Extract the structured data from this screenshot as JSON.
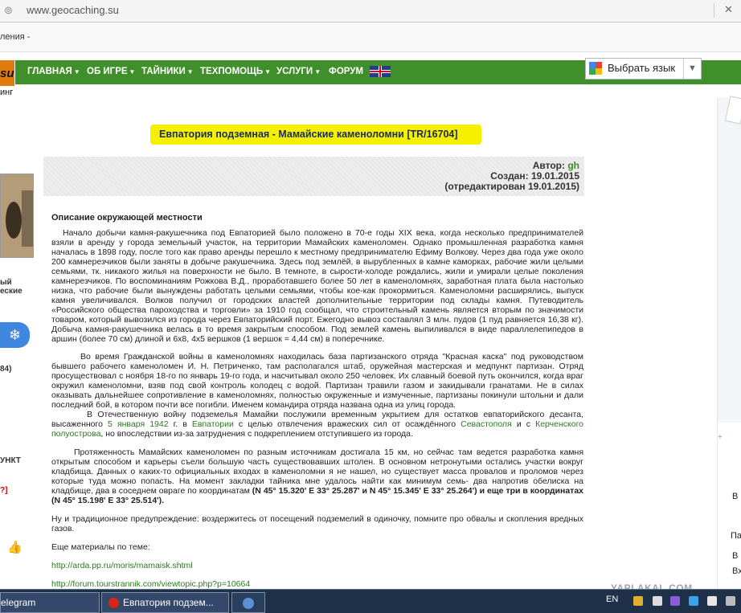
{
  "browser": {
    "url": "www.geocaching.su",
    "bookmarks_text": "ления -"
  },
  "site": {
    "logo_text": "su",
    "logo_sub": "инг",
    "nav": [
      "ГЛАВНАЯ",
      "ОБ ИГРЕ",
      "ТАЙНИКИ",
      "ТЕХПОМОЩЬ",
      "УСЛУГИ",
      "ФОРУМ"
    ],
    "translate_label": "Выбрать язык"
  },
  "cache": {
    "title": "Евпатория подземная - Мамайские каменоломни [TR/16704]",
    "author_label": "Автор:",
    "author": "gh",
    "created": "Создан: 19.01.2015",
    "edited": "(отредактирован 19.01.2015)",
    "section_title": "Описание окружающей местности",
    "p1": "Начало добычи камня-ракушечника под Евпаторией было положено в 70-е годы XIX века, когда несколько предпринимателей взяли в аренду у города земельный участок, на территории Мамайских каменоломен. Однако промышленная разработка камня началась в 1898 году, после того как право аренды перешло к местному предпринимателю Ефиму Волкову. Через два года уже около 200 камнерезчиков были заняты в добыче ракушечника. Здесь под землёй, в вырубленных в камне каморках, рабочие жили целыми семьями, тк. никакого жилья на поверхности не было. В темноте, в сырости-холоде рождались, жили и умирали целые поколения камнерезчиков. По воспоминаниям Рожкова В.Д., проработавшего более 50 лет в каменоломнях, заработная плата была настолько низка, что рабочие были вынуждены работать целыми семьями, чтобы кое-как прокормиться. Каменоломни расширялись, выпуск камня увеличивался. Волков получил от городских властей дополнительные территории под склады камня. Путеводитель «Российского общества пароходства и торговли» за 1910 год сообщал, что строительный камень является вторым по значимости товаром, который вывозился из города через Евпаторийский порт. Ежегодно вывоз составлял 3 млн. пудов (1 пуд равняется 16,38 кг). Добыча камня-ракушечника велась в то время закрытым способом. Под землей камень выпиливался в виде параллелепипедов в аршин (более 70 см) длиной и 6х8, 4х5 вершков (1 вершок = 4,44 см) в поперечнике.",
    "p2": "Во время Гражданской войны в каменоломнях находилась база партизанского отряда \"Красная каска\" под руководством бывшего рабочего каменоломен И. Н. Петриченко, там раcполагался штаб, оружейная мастерская и медпункт партизан. Отряд просуществовал с ноября 18-го по январь 19-го года, и насчитывал около 250 человек. Их славный боевой путь окончился, когда враг окружил каменоломни, взяв под свой контроль колодец с водой. Партизан травили газом и закидывали гранатами. Не в силах оказывать дальнейшее сопротивление в каменоломнях, полностью окруженные и измученные, партизаны покинули штольни и дали последний бой, в котором почти все погибли. Именем командира отряда названа одна из улиц города.",
    "p3_a": "В Отечественную войну подземелья Мамайки послужили временным укрытием для остатков евпаторийского десанта, высаженного ",
    "p3_link1": "5 января",
    "p3_link2": "1942",
    "p3_b": " г. в ",
    "p3_link3": "Евпатории",
    "p3_c": " с целью отвлечения вражеских сил от осаждённого ",
    "p3_link4": "Севастополя",
    "p3_d": " и с ",
    "p3_link5": "Керченского полуострова",
    "p3_e": ", но впоследствии из-за затруднения с подкреплением отступившего из города.",
    "p4_a": "Протяженность Мамайских каменоломен по разным источникам достигала 15 км, но сейчас там ведется разработка камня открытым способом и карьеры съели большую часть существовавших штолен.  В основном нетронутыми остались участки вокруг кладбища. Данных о каких-то официальных входах в каменоломни я не нашел, но существует масса провалов и проломов через которые туда можно попасть. На момент закладки тайника мне удалось найти как минимум семь- два напротив обелиска на кладбище,  два в соседнем овраге по координатам ",
    "p4_bold": "(N 45° 15.320' E 33° 25.287' и N 45° 15.345' E 33° 25.264') и еще три в координатах (N 45° 15.198' E 33° 25.514').",
    "p5": "Ну и традиционное предупреждение: воздержитесь от посещений подземелий в одиночку, помните про обвалы и скопления вредных газов.",
    "p6": "Еще материалы по теме:",
    "link_1": "http://arda.pp.ru/moris/mamaisk.shtml",
    "link_2": "http://forum.tourstrannik.com/viewtopic.php?p=10664"
  },
  "left_sidebar": {
    "text_1": "ый",
    "text_2": "еские",
    "text_3": "84)",
    "text_4": "УНКТ",
    "text_5": "?]"
  },
  "right_sidebar": {
    "text_1": "В",
    "text_2": "Па",
    "text_3": "В",
    "text_4": "Вх"
  },
  "taskbar": {
    "task_1": "elegram",
    "task_2": "Евпатория подзем...",
    "lang": "EN"
  },
  "watermark": "YAPLAKAL.COM"
}
